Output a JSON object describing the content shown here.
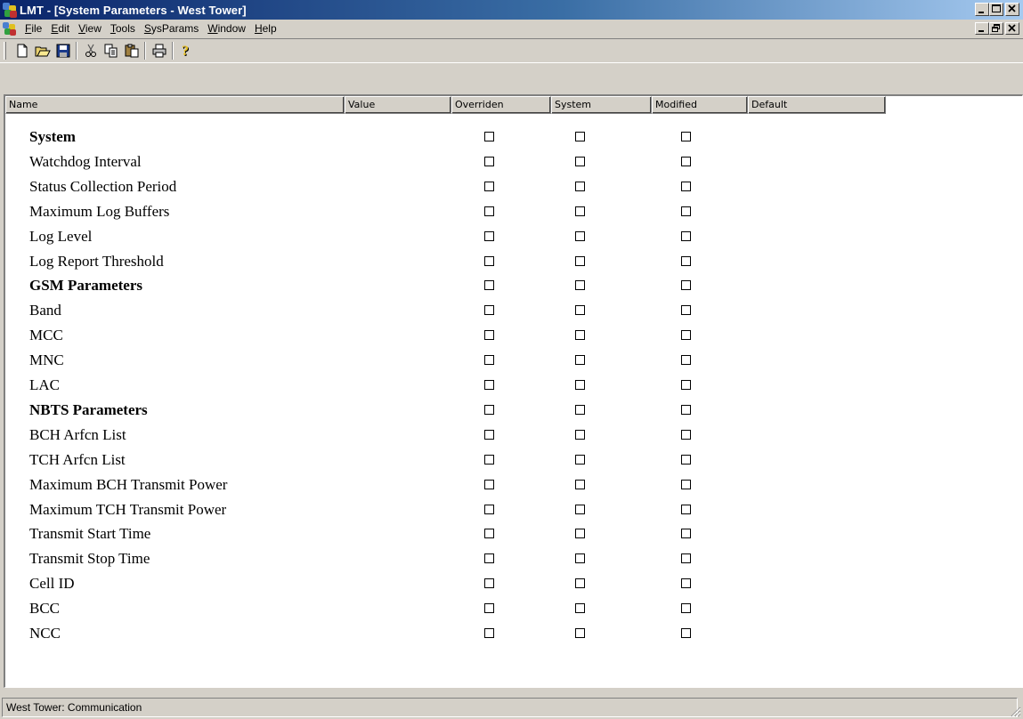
{
  "window": {
    "title": "LMT - [System Parameters - West Tower]",
    "minimize_label": "_",
    "maximize_label": "□",
    "close_label": "×"
  },
  "menubar": {
    "items": [
      {
        "label": "File",
        "accel": "F"
      },
      {
        "label": "Edit",
        "accel": "E"
      },
      {
        "label": "View",
        "accel": "V"
      },
      {
        "label": "Tools",
        "accel": "T"
      },
      {
        "label": "SysParams",
        "accel": "S"
      },
      {
        "label": "Window",
        "accel": "W"
      },
      {
        "label": "Help",
        "accel": "H"
      }
    ],
    "mdi_minimize_label": "_",
    "mdi_restore_label": "▫",
    "mdi_close_label": "×"
  },
  "toolbar": {
    "icons": [
      "new-icon",
      "open-icon",
      "save-icon",
      "cut-icon",
      "copy-icon",
      "paste-icon",
      "print-icon",
      "help-icon"
    ]
  },
  "table": {
    "columns": [
      "Name",
      "Value",
      "Overriden",
      "System",
      "Modified",
      "Default"
    ],
    "rows": [
      {
        "name": "System",
        "bold": true,
        "overriden": false,
        "system": false,
        "modified": false
      },
      {
        "name": "Watchdog Interval",
        "bold": false,
        "overriden": false,
        "system": false,
        "modified": false
      },
      {
        "name": "Status Collection Period",
        "bold": false,
        "overriden": false,
        "system": false,
        "modified": false
      },
      {
        "name": "Maximum Log Buffers",
        "bold": false,
        "overriden": false,
        "system": false,
        "modified": false
      },
      {
        "name": "Log Level",
        "bold": false,
        "overriden": false,
        "system": false,
        "modified": false
      },
      {
        "name": "Log Report Threshold",
        "bold": false,
        "overriden": false,
        "system": false,
        "modified": false
      },
      {
        "name": "GSM Parameters",
        "bold": true,
        "overriden": false,
        "system": false,
        "modified": false
      },
      {
        "name": "Band",
        "bold": false,
        "overriden": false,
        "system": false,
        "modified": false
      },
      {
        "name": "MCC",
        "bold": false,
        "overriden": false,
        "system": false,
        "modified": false
      },
      {
        "name": "MNC",
        "bold": false,
        "overriden": false,
        "system": false,
        "modified": false
      },
      {
        "name": "LAC",
        "bold": false,
        "overriden": false,
        "system": false,
        "modified": false
      },
      {
        "name": "NBTS Parameters",
        "bold": true,
        "overriden": false,
        "system": false,
        "modified": false
      },
      {
        "name": "BCH Arfcn List",
        "bold": false,
        "overriden": false,
        "system": false,
        "modified": false
      },
      {
        "name": "TCH Arfcn List",
        "bold": false,
        "overriden": false,
        "system": false,
        "modified": false
      },
      {
        "name": "Maximum BCH Transmit Power",
        "bold": false,
        "overriden": false,
        "system": false,
        "modified": false
      },
      {
        "name": "Maximum TCH Transmit Power",
        "bold": false,
        "overriden": false,
        "system": false,
        "modified": false
      },
      {
        "name": "Transmit Start Time",
        "bold": false,
        "overriden": false,
        "system": false,
        "modified": false
      },
      {
        "name": "Transmit Stop Time",
        "bold": false,
        "overriden": false,
        "system": false,
        "modified": false
      },
      {
        "name": "Cell ID",
        "bold": false,
        "overriden": false,
        "system": false,
        "modified": false
      },
      {
        "name": "BCC",
        "bold": false,
        "overriden": false,
        "system": false,
        "modified": false
      },
      {
        "name": "NCC",
        "bold": false,
        "overriden": false,
        "system": false,
        "modified": false
      }
    ]
  },
  "statusbar": {
    "text": "West Tower: Communication"
  }
}
